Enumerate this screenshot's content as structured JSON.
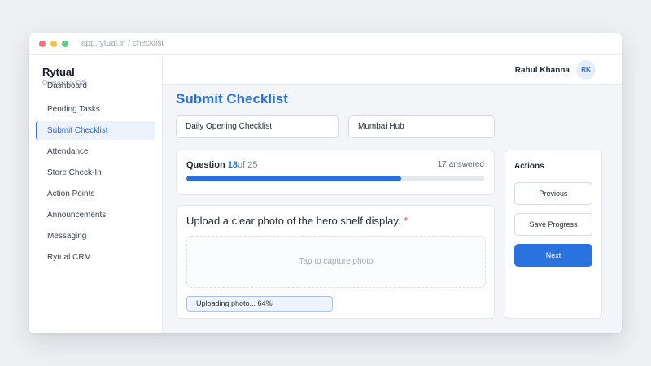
{
  "browser": {
    "url": "app.rytual.in / checklist"
  },
  "sidebar": {
    "brand": "Rytual",
    "brand_subtitle": "Operations OS",
    "items": [
      {
        "label": "Dashboard",
        "active": false
      },
      {
        "label": "Pending Tasks",
        "active": false
      },
      {
        "label": "Submit Checklist",
        "active": true
      },
      {
        "label": "Attendance",
        "active": false
      },
      {
        "label": "Store Check-In",
        "active": false
      },
      {
        "label": "Action Points",
        "active": false
      },
      {
        "label": "Announcements",
        "active": false
      },
      {
        "label": "Messaging",
        "active": false
      },
      {
        "label": "Rytual CRM",
        "active": false
      }
    ]
  },
  "header": {
    "user_name": "Rahul Khanna",
    "avatar_initials": "RK"
  },
  "page": {
    "title": "Submit Checklist",
    "checklist_select": "Daily Opening Checklist",
    "location_select": "Mumbai Hub"
  },
  "progress": {
    "question_prefix": "Question",
    "current": "18",
    "of_total": "of 25",
    "answered": "17 answered",
    "fraction": 0.72
  },
  "question": {
    "text": "Upload a clear photo of the hero shelf display.",
    "required_mark": "*",
    "dropzone_text": "Tap to capture photo",
    "upload_status": "Uploading photo... 64%"
  },
  "actions": {
    "title": "Actions",
    "previous": "Previous",
    "save": "Save Progress",
    "next": "Next"
  },
  "colors": {
    "accent": "#2a72d9",
    "primary_button": "#2a72e0",
    "required": "#e24a4a"
  }
}
